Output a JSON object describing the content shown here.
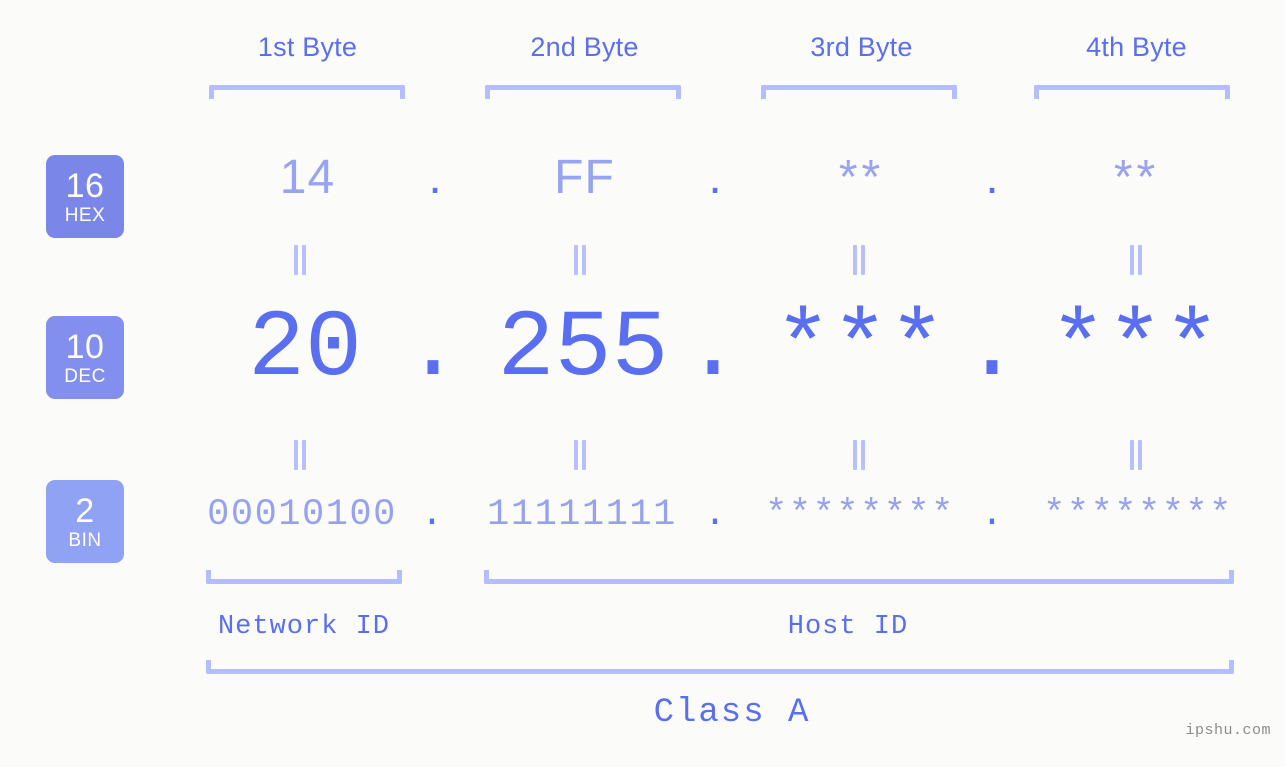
{
  "meta": {
    "background": "#fbfcf9",
    "accent": "#5a6ef0",
    "accent_light": "#98a4f2",
    "bracket_color": "#b4beff"
  },
  "header": {
    "byte_labels": [
      {
        "label": "1st Byte"
      },
      {
        "label": "2nd Byte"
      },
      {
        "label": "3rd Byte"
      },
      {
        "label": "4th Byte"
      }
    ]
  },
  "base_badges": [
    {
      "num": "16",
      "name": "HEX",
      "color": "#7b87e8"
    },
    {
      "num": "10",
      "name": "DEC",
      "color": "#828fee"
    },
    {
      "num": "2",
      "name": "BIN",
      "color": "#8fa2f4"
    }
  ],
  "rows": {
    "hex": {
      "base": "16",
      "label": "HEX",
      "values": [
        "14",
        "FF",
        "**",
        "**"
      ],
      "separator": "."
    },
    "dec": {
      "base": "10",
      "label": "DEC",
      "values": [
        "20",
        "255",
        "***",
        "***"
      ],
      "separator": "."
    },
    "bin": {
      "base": "2",
      "label": "BIN",
      "values": [
        "00010100",
        "11111111",
        "********",
        "********"
      ],
      "separator": "."
    }
  },
  "equals_marks": {
    "glyph": "||",
    "count_per_row": 4
  },
  "footer": {
    "network_id_label": "Network ID",
    "host_id_label": "Host ID",
    "class_label": "Class A"
  },
  "watermark": {
    "text": "ipshu.com"
  }
}
